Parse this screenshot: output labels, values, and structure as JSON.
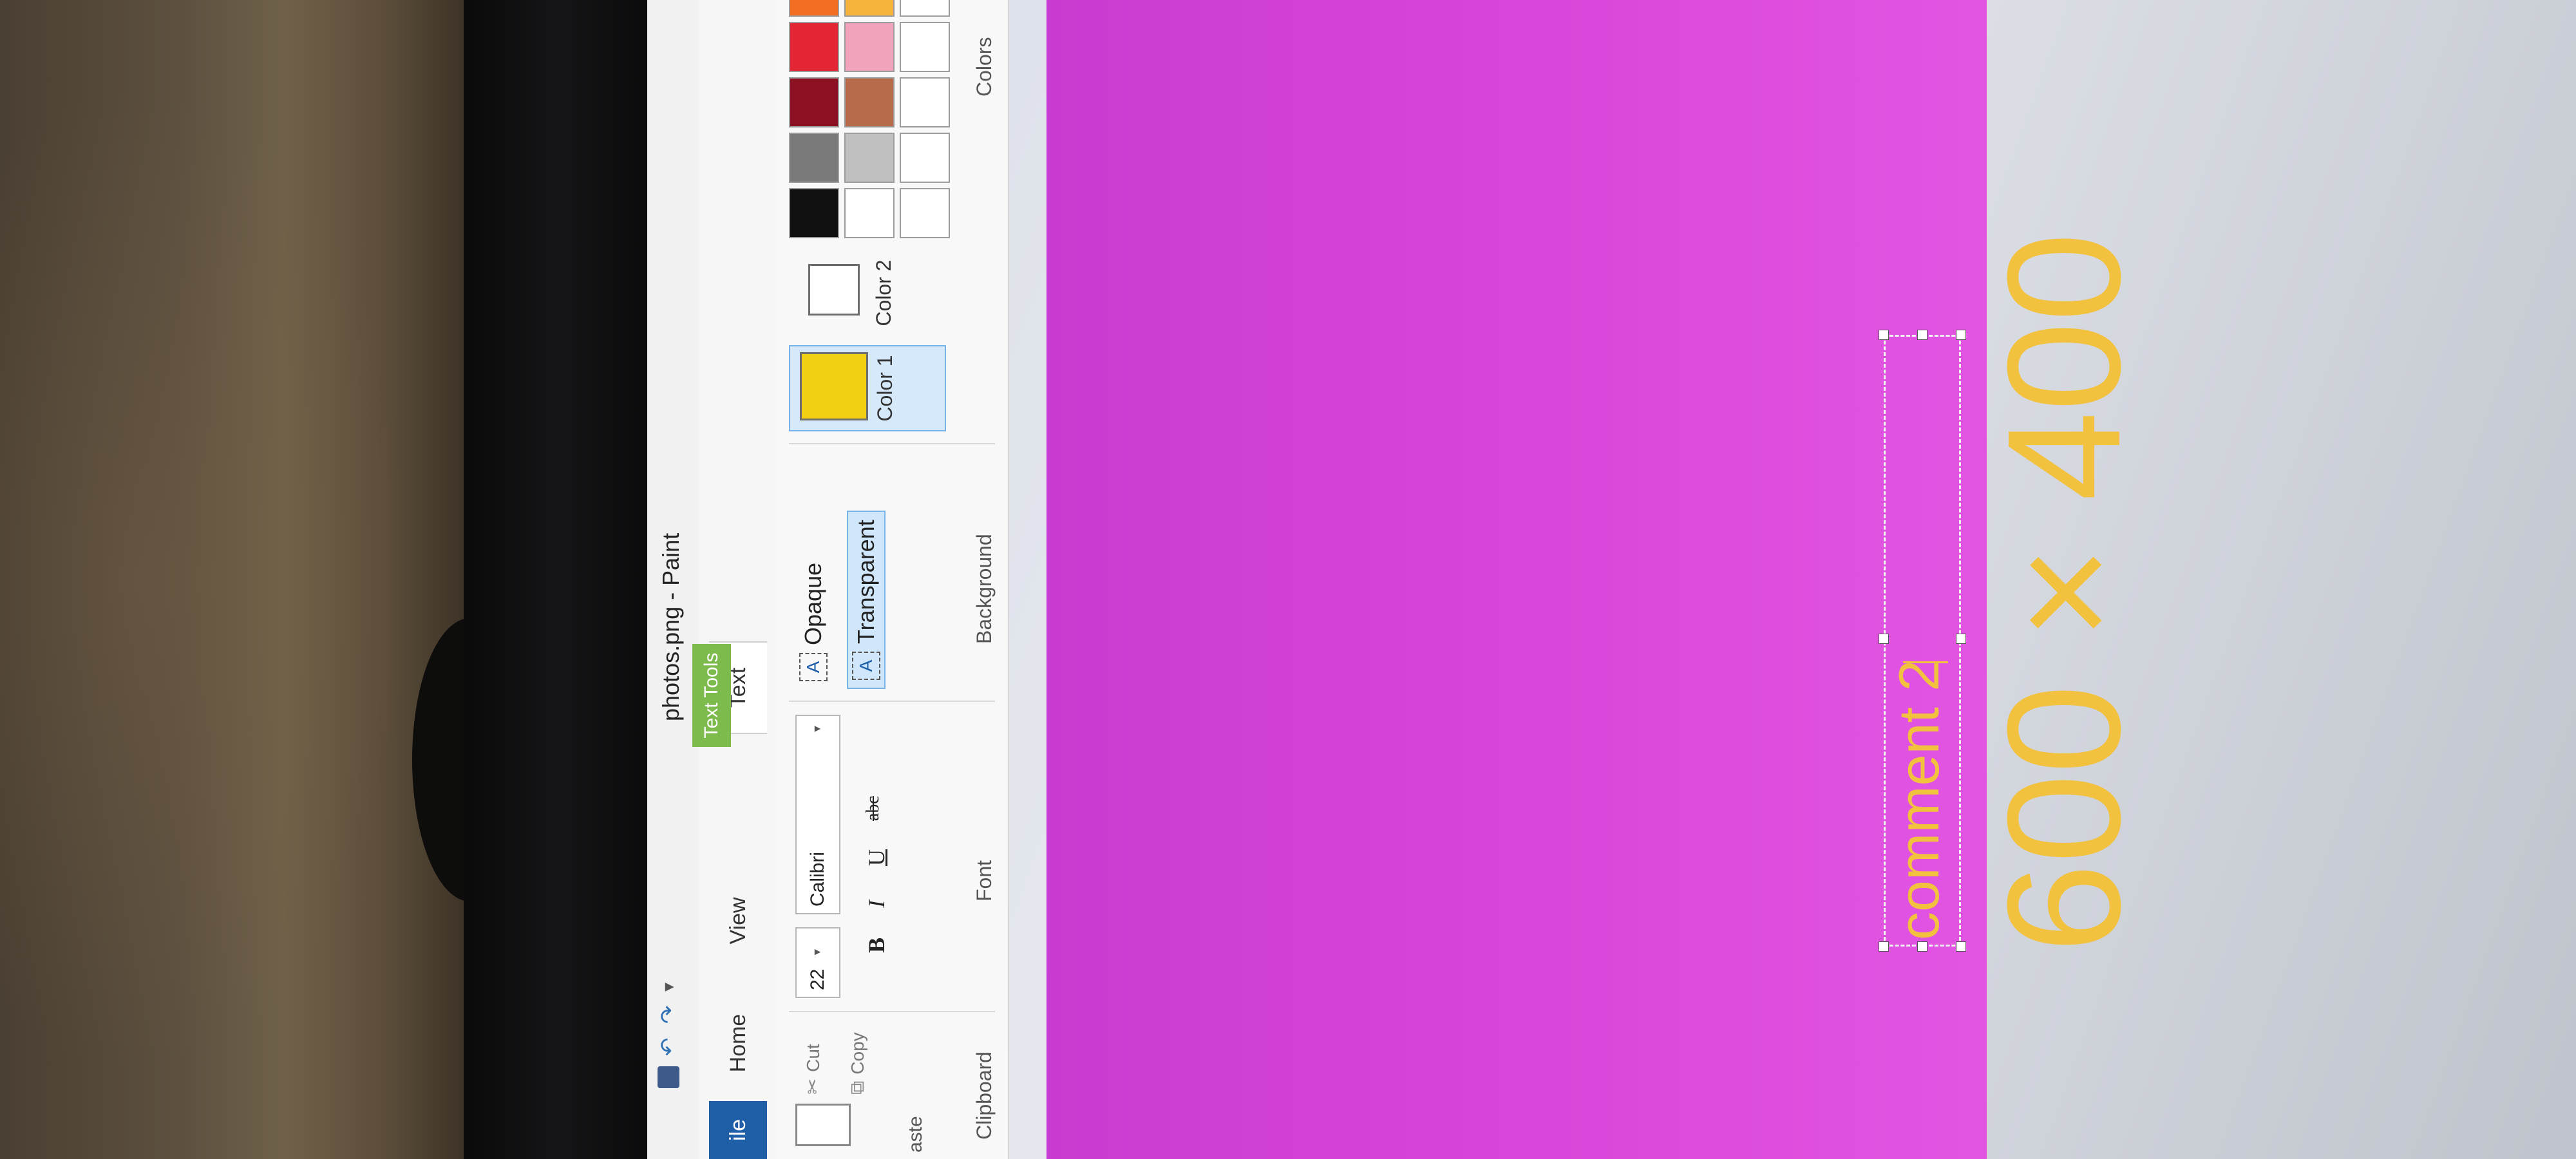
{
  "window": {
    "title": "photos.png - Paint",
    "contextual_tab": "Text Tools"
  },
  "tabs": {
    "file": "ile",
    "home": "Home",
    "view": "View",
    "text": "Text"
  },
  "clipboard": {
    "paste_label": "aste",
    "cut": "Cut",
    "copy": "Copy",
    "group_label": "Clipboard"
  },
  "font": {
    "size": "22",
    "name": "Calibri",
    "bold": "B",
    "italic": "I",
    "underline": "U",
    "strike": "abc",
    "group_label": "Font"
  },
  "background": {
    "opaque": "Opaque",
    "transparent": "Transparent",
    "group_label": "Background"
  },
  "colors": {
    "color1_label": "Color 1",
    "color2_label": "Color 2",
    "group_label": "Colors",
    "color1": "#f1cf12",
    "color2": "#ffffff",
    "palette": [
      "#111111",
      "#7a7a7a",
      "#8b1022",
      "#e32634",
      "#f26d22",
      "#f7d11a",
      "#ffffff",
      "#c0c0c0",
      "#b86b4a",
      "#f2a3bc",
      "#f7b43a",
      "#efe4a8",
      "#ffffff",
      "#ffffff",
      "#ffffff",
      "#ffffff",
      "#ffffff",
      "#ffffff"
    ]
  },
  "canvas": {
    "background": "#d646d8",
    "comment_text": "comment 2",
    "dimension_text": "600 × 400",
    "text_color": "#f2c13d"
  }
}
